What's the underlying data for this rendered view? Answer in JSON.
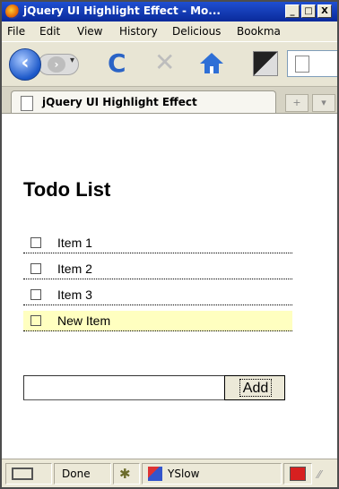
{
  "window": {
    "title": "jQuery UI Highlight Effect - Mo...",
    "controls": {
      "minimize": "_",
      "maximize": "□",
      "close": "X"
    }
  },
  "menu": {
    "items": [
      "File",
      "Edit",
      "View",
      "History",
      "Delicious",
      "Bookma"
    ]
  },
  "toolbar": {
    "back_glyph": "‹",
    "forward_glyph": "›",
    "dropdown_glyph": "▾",
    "reload_glyph": "C",
    "stop_glyph": "✕",
    "icons": [
      "back-icon",
      "forward-icon",
      "reload-icon",
      "stop-icon",
      "home-icon",
      "bookmark-icon",
      "page-icon"
    ]
  },
  "tabs": {
    "active_label": "jQuery UI Highlight Effect",
    "new_tab_glyph": "+",
    "list_glyph": "▾"
  },
  "page": {
    "title": "Todo List",
    "items": [
      {
        "label": "Item 1",
        "highlighted": false
      },
      {
        "label": "Item 2",
        "highlighted": false
      },
      {
        "label": "Item 3",
        "highlighted": false
      },
      {
        "label": "New Item",
        "highlighted": true
      }
    ],
    "input_value": "",
    "add_button_label": "Add",
    "highlight_color": "#ffffc0"
  },
  "statusbar": {
    "status_text": "Done",
    "yslow_label": "YSlow",
    "firebug_glyph": "✱"
  }
}
